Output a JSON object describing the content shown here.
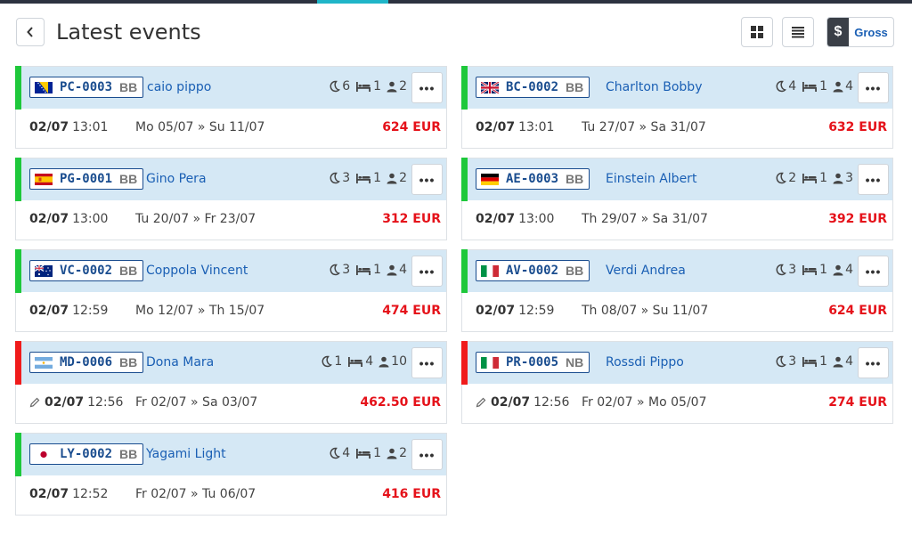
{
  "header": {
    "title": "Latest events",
    "gross_currency": "$",
    "gross_label": "Gross"
  },
  "colors": {
    "confirmed": "#1ec83b",
    "cancelled": "#f01b1b",
    "price": "#e5121a",
    "link": "#1a5fb4"
  },
  "events": [
    {
      "flag": "bosnia-flag",
      "code": "PC-0003",
      "board": "BB",
      "guest": "caio pippo",
      "nights": "6",
      "rooms": "1",
      "guests": "2",
      "status": "confirmed",
      "date": "02/07",
      "time": "13:01",
      "edited": false,
      "range": "Mo 05/07 » Su 11/07",
      "price": "624 EUR"
    },
    {
      "flag": "uk-flag",
      "code": "BC-0002",
      "board": "BB",
      "guest": "Charlton Bobby",
      "nights": "4",
      "rooms": "1",
      "guests": "4",
      "status": "confirmed",
      "date": "02/07",
      "time": "13:01",
      "edited": false,
      "range": "Tu 27/07 » Sa 31/07",
      "price": "632 EUR"
    },
    {
      "flag": "spain-flag",
      "code": "PG-0001",
      "board": "BB",
      "guest": "Gino Pera",
      "nights": "3",
      "rooms": "1",
      "guests": "2",
      "status": "confirmed",
      "date": "02/07",
      "time": "13:00",
      "edited": false,
      "range": "Tu 20/07 » Fr 23/07",
      "price": "312 EUR"
    },
    {
      "flag": "germany-flag",
      "code": "AE-0003",
      "board": "BB",
      "guest": "Einstein Albert",
      "nights": "2",
      "rooms": "1",
      "guests": "3",
      "status": "confirmed",
      "date": "02/07",
      "time": "13:00",
      "edited": false,
      "range": "Th 29/07 » Sa 31/07",
      "price": "392 EUR"
    },
    {
      "flag": "australia-flag",
      "code": "VC-0002",
      "board": "BB",
      "guest": "Coppola Vincent",
      "nights": "3",
      "rooms": "1",
      "guests": "4",
      "status": "confirmed",
      "date": "02/07",
      "time": "12:59",
      "edited": false,
      "range": "Mo 12/07 » Th 15/07",
      "price": "474 EUR"
    },
    {
      "flag": "italy-flag",
      "code": "AV-0002",
      "board": "BB",
      "guest": "Verdi Andrea",
      "nights": "3",
      "rooms": "1",
      "guests": "4",
      "status": "confirmed",
      "date": "02/07",
      "time": "12:59",
      "edited": false,
      "range": "Th 08/07 » Su 11/07",
      "price": "624 EUR"
    },
    {
      "flag": "argentina-flag",
      "code": "MD-0006",
      "board": "BB",
      "guest": "Dona Mara",
      "nights": "1",
      "rooms": "4",
      "guests": "10",
      "status": "cancelled",
      "date": "02/07",
      "time": "12:56",
      "edited": true,
      "range": "Fr 02/07 » Sa 03/07",
      "price": "462.50 EUR"
    },
    {
      "flag": "italy-flag",
      "code": "PR-0005",
      "board": "NB",
      "guest": "Rossdi Pippo",
      "nights": "3",
      "rooms": "1",
      "guests": "4",
      "status": "cancelled",
      "date": "02/07",
      "time": "12:56",
      "edited": true,
      "range": "Fr 02/07 » Mo 05/07",
      "price": "274 EUR"
    },
    {
      "flag": "japan-flag",
      "code": "LY-0002",
      "board": "BB",
      "guest": "Yagami Light",
      "nights": "4",
      "rooms": "1",
      "guests": "2",
      "status": "confirmed",
      "date": "02/07",
      "time": "12:52",
      "edited": false,
      "range": "Fr 02/07 » Tu 06/07",
      "price": "416 EUR"
    }
  ]
}
